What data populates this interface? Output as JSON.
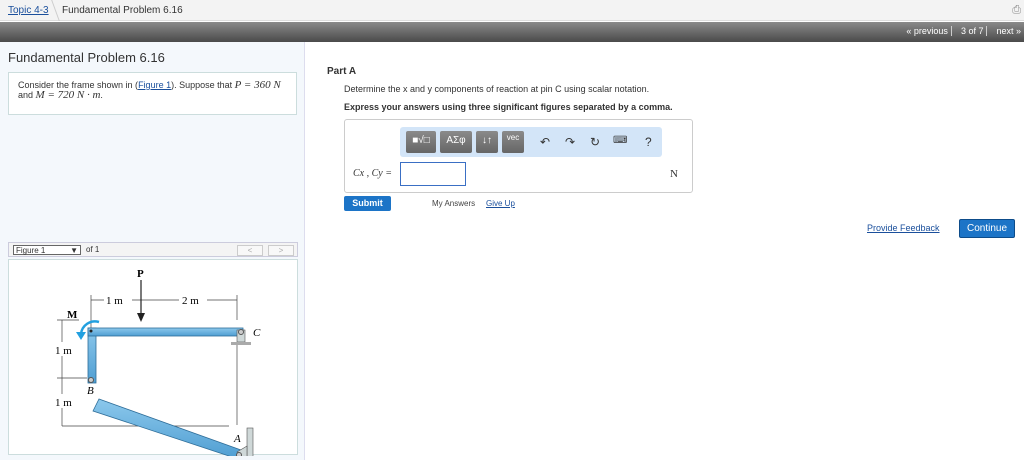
{
  "breadcrumb": {
    "topic": "Topic 4-3",
    "current": "Fundamental Problem 6.16"
  },
  "pager": {
    "previous": "« previous",
    "position": "3 of 7",
    "next": "next »"
  },
  "problem": {
    "title": "Fundamental Problem 6.16",
    "text_pre": "Consider the frame shown in (",
    "figure_link": "Figure 1",
    "text_mid": "). Suppose that ",
    "P_eq": "P = 360 N",
    "text_and": "and ",
    "M_eq": "M = 720 N · m",
    "text_end": "."
  },
  "figure": {
    "select": "Figure 1",
    "of": "of 1",
    "prev": "<",
    "next": ">",
    "labels": {
      "P": "P",
      "M": "M",
      "d1": "1 m",
      "d2": "2 m",
      "h1": "1 m",
      "h2": "1 m",
      "A": "A",
      "B": "B",
      "C": "C"
    }
  },
  "part": {
    "title": "Part A",
    "question": "Determine the x and y components of reaction at pin C using scalar notation.",
    "instruction": "Express your answers using three significant figures separated by a comma.",
    "toolbar": {
      "templates": "■√□",
      "greek": "ΑΣφ",
      "arrows": "↓↑",
      "vec": "vec",
      "help": "?"
    },
    "answer_label": "Cx , Cy =",
    "answer_value": "",
    "unit": "N",
    "submit": "Submit",
    "my_answers": "My Answers",
    "give_up": "Give Up"
  },
  "footer": {
    "feedback": "Provide Feedback",
    "continue": "Continue"
  }
}
